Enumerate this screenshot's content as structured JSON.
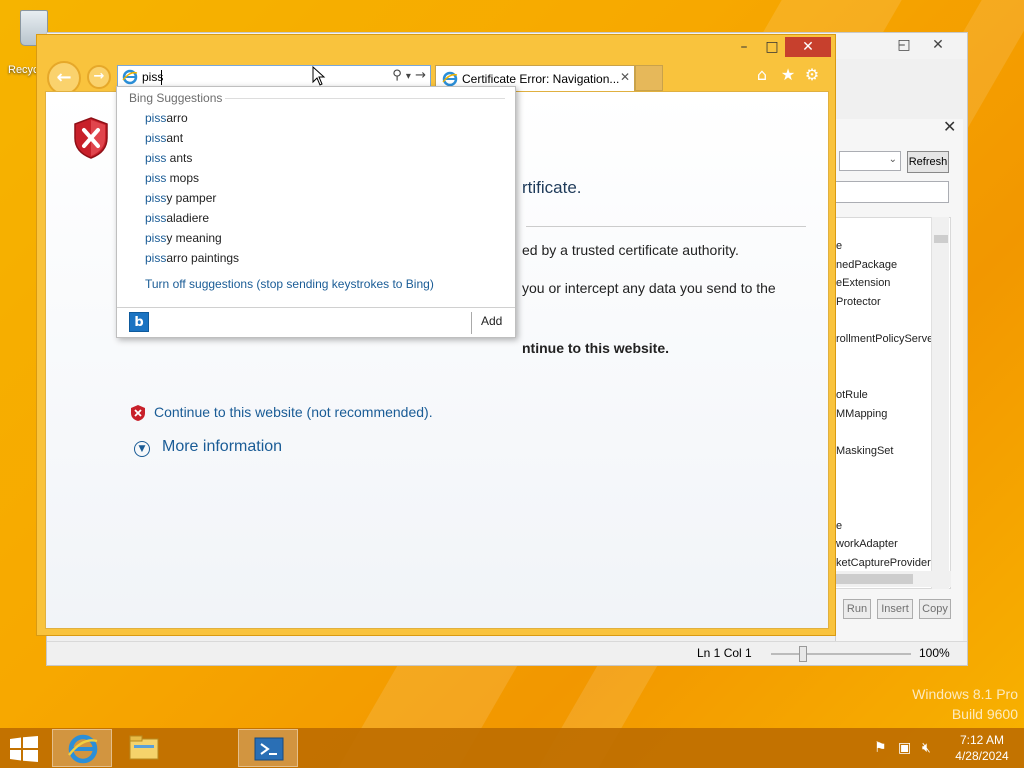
{
  "desktop": {
    "recycle_label": "Recyc",
    "watermark_line1": "Windows 8.1 Pro",
    "watermark_line2": "Build 9600"
  },
  "ise": {
    "refresh_label": "Refresh",
    "commands": [
      "e",
      "nedPackage",
      "eExtension",
      "Protector",
      "rollmentPolicyServe",
      "otRule",
      "MMapping",
      "MaskingSet",
      "e",
      "workAdapter",
      "ketCaptureProvider"
    ],
    "run_label": "Run",
    "insert_label": "Insert",
    "copy_label": "Copy",
    "status_position": "Ln 1  Col 1",
    "zoom": "100%"
  },
  "ie": {
    "address_value": "piss",
    "tab_title": "Certificate Error: Navigation...",
    "page": {
      "heading_fragment": "rtificate.",
      "line1": "ed by a trusted certificate authority.",
      "line2": "you or intercept any data you send to the",
      "line3": "",
      "line4": "ntinue to this website.",
      "continue_link": "Continue to this website (not recommended).",
      "more_info": "More information"
    },
    "suggestions": {
      "header": "Bing Suggestions",
      "typed": "piss",
      "items": [
        {
          "prefix": "piss",
          "rest": "arro"
        },
        {
          "prefix": "piss",
          "rest": "ant"
        },
        {
          "prefix": "piss",
          "rest": " ants"
        },
        {
          "prefix": "piss",
          "rest": " mops"
        },
        {
          "prefix": "piss",
          "rest": "y pamper"
        },
        {
          "prefix": "piss",
          "rest": "aladiere"
        },
        {
          "prefix": "piss",
          "rest": "y meaning"
        },
        {
          "prefix": "piss",
          "rest": "arro paintings"
        }
      ],
      "turn_off": "Turn off suggestions (stop sending keystrokes to Bing)",
      "add_label": "Add"
    }
  },
  "taskbar": {
    "time": "7:12 AM",
    "date": "4/28/2024"
  },
  "colors": {
    "accent_link": "#1a5c96",
    "ie_frame": "#f9c33d",
    "close_red": "#c7402d"
  }
}
